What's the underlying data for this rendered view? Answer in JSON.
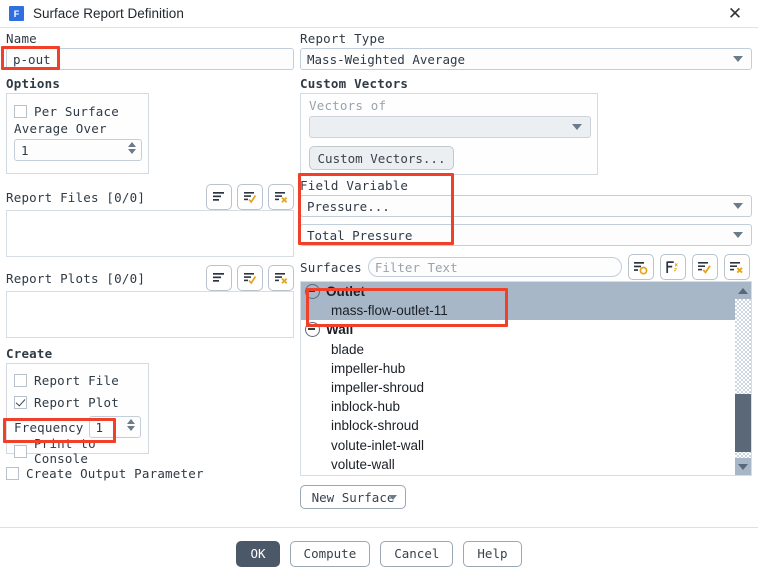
{
  "window": {
    "title": "Surface Report Definition",
    "app_icon_letter": "F",
    "close_label": "✕"
  },
  "left": {
    "name_label": "Name",
    "name_value": "p-out",
    "options_label": "Options",
    "per_surface_label": "Per Surface",
    "per_surface_checked": false,
    "average_over_label": "Average Over",
    "average_over_value": "1",
    "report_files_label": "Report Files [0/0]",
    "report_plots_label": "Report Plots [0/0]",
    "create_label": "Create",
    "report_file_label": "Report File",
    "report_file_checked": false,
    "report_plot_label": "Report Plot",
    "report_plot_checked": true,
    "frequency_label": "Frequency",
    "frequency_value": "1",
    "print_to_console_label": "Print to Console",
    "print_to_console_checked": false,
    "create_output_parameter_label": "Create Output Parameter",
    "create_output_parameter_checked": false,
    "list_icons": [
      "list-new-icon",
      "list-edit-icon",
      "list-delete-icon"
    ]
  },
  "right": {
    "report_type_label": "Report Type",
    "report_type_value": "Mass-Weighted Average",
    "custom_vectors_label": "Custom Vectors",
    "vectors_of_label": "Vectors of",
    "vectors_of_value": "",
    "custom_vectors_button": "Custom Vectors...",
    "field_variable_label": "Field Variable",
    "field_variable_category": "Pressure...",
    "field_variable_value": "Total Pressure",
    "surfaces_label": "Surfaces",
    "filter_placeholder": "Filter Text",
    "surface_icons": [
      "select-shape-icon",
      "select-filter-icon",
      "select-all-icon",
      "deselect-all-icon"
    ],
    "new_surface_button": "New Surface",
    "tree": [
      {
        "label": "Outlet",
        "type": "group",
        "selected": true,
        "expanded": true
      },
      {
        "label": "mass-flow-outlet-11",
        "type": "child",
        "selected": true
      },
      {
        "label": "Wall",
        "type": "group",
        "selected": false,
        "expanded": true
      },
      {
        "label": "blade",
        "type": "child",
        "selected": false
      },
      {
        "label": "impeller-hub",
        "type": "child",
        "selected": false
      },
      {
        "label": "impeller-shroud",
        "type": "child",
        "selected": false
      },
      {
        "label": "inblock-hub",
        "type": "child",
        "selected": false
      },
      {
        "label": "inblock-shroud",
        "type": "child",
        "selected": false
      },
      {
        "label": "volute-inlet-wall",
        "type": "child",
        "selected": false
      },
      {
        "label": "volute-wall",
        "type": "child",
        "selected": false
      }
    ]
  },
  "footer": {
    "ok": "OK",
    "compute": "Compute",
    "cancel": "Cancel",
    "help": "Help"
  },
  "colors": {
    "highlight_annotation": "#f0402a",
    "selection": "#a7b7c8",
    "accent_icon": "#e8a317",
    "primary_button": "#4a5868"
  }
}
